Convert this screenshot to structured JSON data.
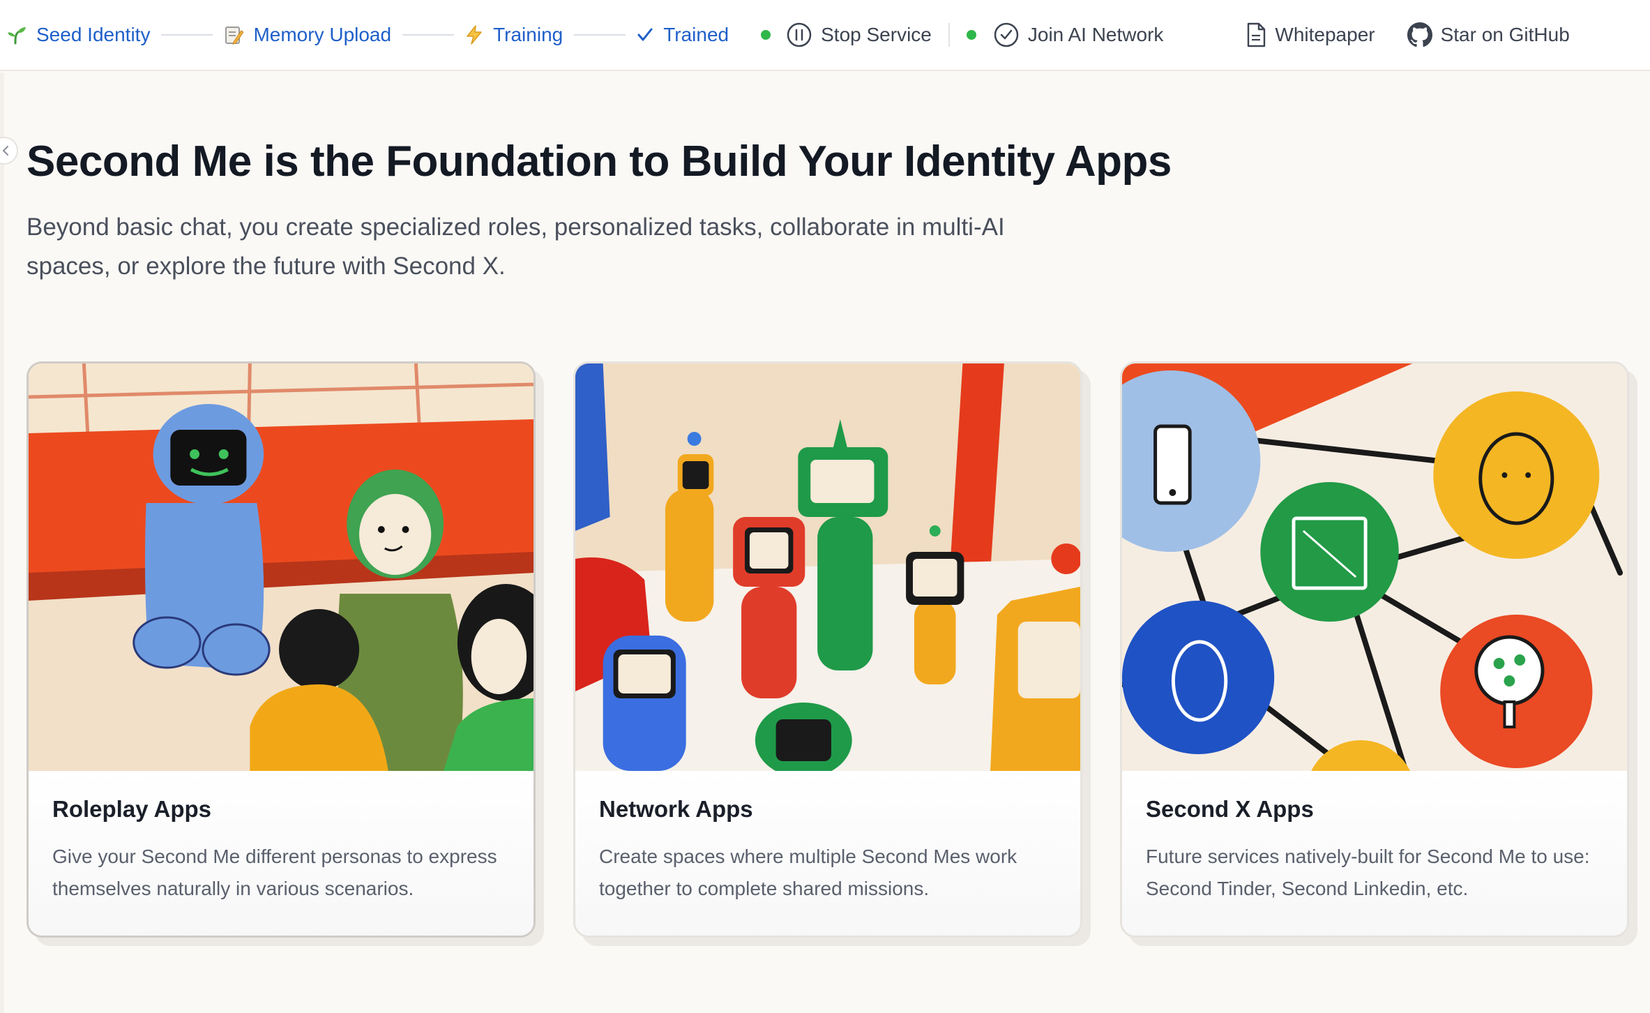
{
  "topbar": {
    "steps": [
      {
        "label": "Seed Identity",
        "icon": "sprout-icon"
      },
      {
        "label": "Memory Upload",
        "icon": "memo-icon"
      },
      {
        "label": "Training",
        "icon": "lightning-icon"
      },
      {
        "label": "Trained",
        "icon": "check-icon"
      }
    ],
    "stop_service": "Stop Service",
    "join_network": "Join AI Network",
    "whitepaper": "Whitepaper",
    "github": "Star on GitHub",
    "status_color": "#2fb64a",
    "accent_color": "#1f5fc9"
  },
  "hero": {
    "title": "Second Me is the Foundation to Build Your Identity Apps",
    "subtitle": "Beyond basic chat, you create specialized roles, personalized tasks, collaborate in multi-AI spaces, or explore the future with Second X."
  },
  "cards": [
    {
      "title": "Roleplay Apps",
      "description": "Give your Second Me different personas to express themselves naturally in various scenarios.",
      "illustration": "robot-and-people-illustration"
    },
    {
      "title": "Network Apps",
      "description": "Create spaces where multiple Second Mes work together to complete shared missions.",
      "illustration": "robots-group-illustration"
    },
    {
      "title": "Second X Apps",
      "description": "Future services natively-built for Second Me to use: Second Tinder, Second Linkedin, etc.",
      "illustration": "connected-icons-network-illustration"
    }
  ]
}
